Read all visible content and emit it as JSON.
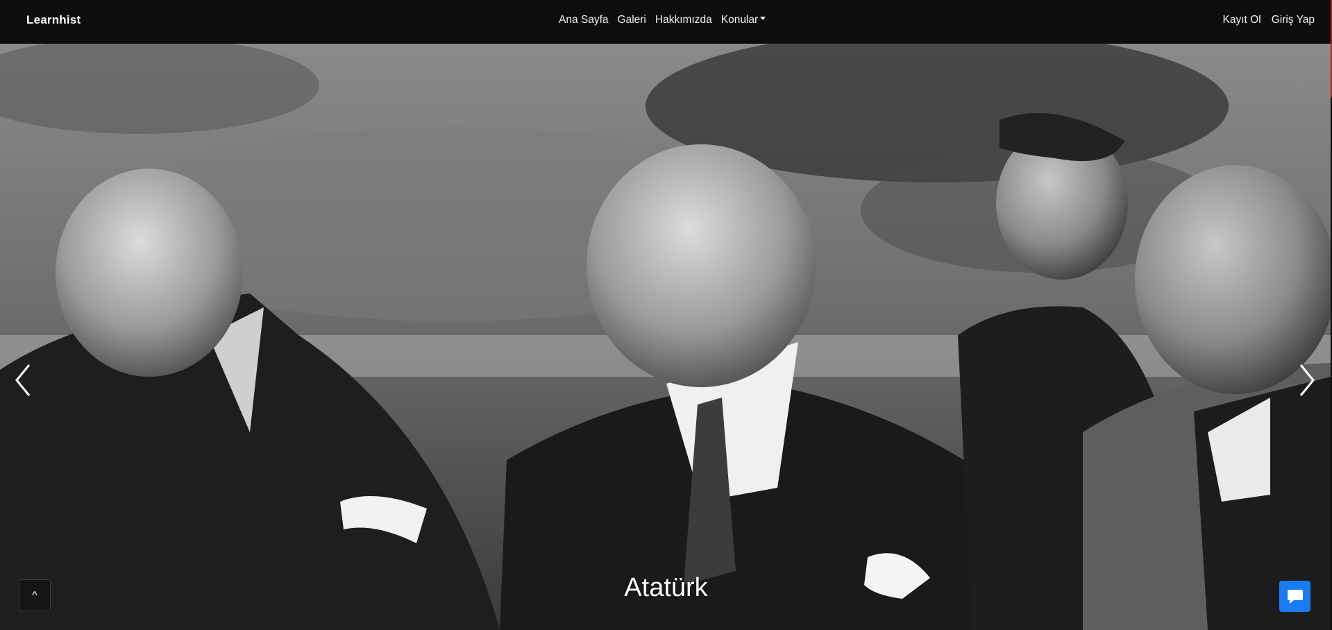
{
  "navbar": {
    "brand": "Learnhist",
    "links": [
      "Ana Sayfa",
      "Galeri",
      "Hakkımızda",
      "Konular"
    ],
    "auth": {
      "register": "Kayıt Ol",
      "login": "Giriş Yap"
    }
  },
  "carousel": {
    "caption": "Atatürk",
    "image_description": "black-and-white photo of men in suits",
    "prev_icon": "chevron-left-icon",
    "next_icon": "chevron-right-icon"
  },
  "controls": {
    "to_top_label": "^",
    "chat_icon": "chat-bubble-icon"
  },
  "colors": {
    "navbar_bg": "#0d0d0d",
    "chat_button": "#1a7cf0"
  }
}
